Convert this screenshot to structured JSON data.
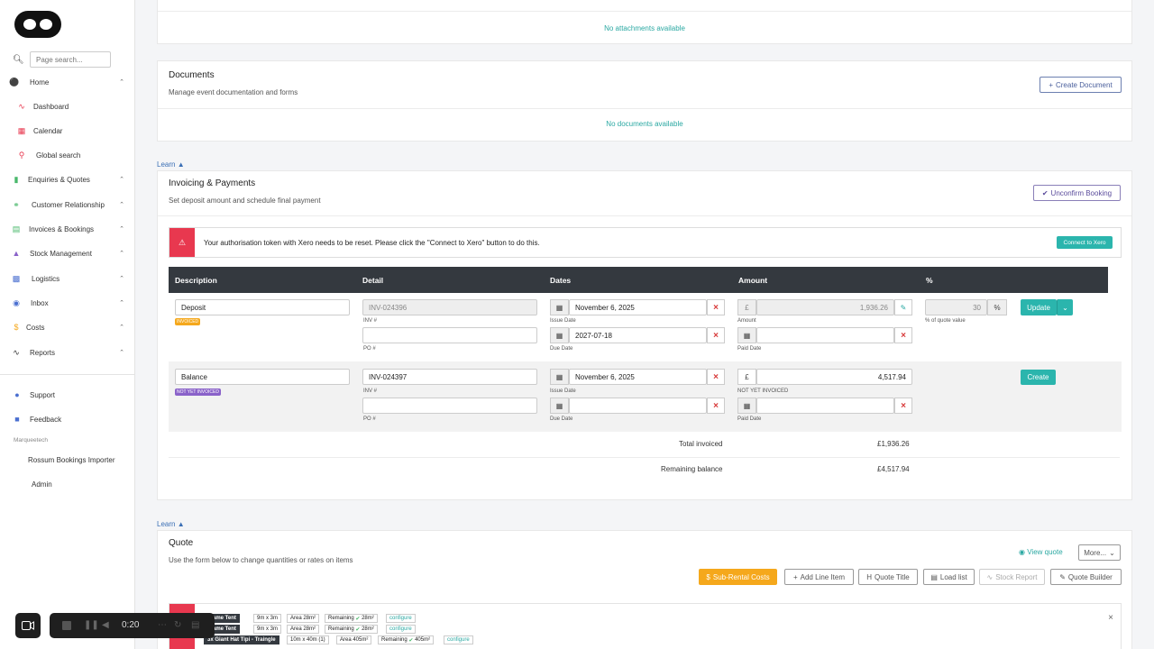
{
  "search": {
    "placeholder": "Page search..."
  },
  "nav": {
    "home": "Home",
    "dashboard": "Dashboard",
    "calendar": "Calendar",
    "global_search": "Global search",
    "enquiries": "Enquiries & Quotes",
    "crm": "Customer Relationship",
    "invoices": "Invoices & Bookings",
    "stock": "Stock Management",
    "logistics": "Logistics",
    "inbox": "Inbox",
    "costs": "Costs",
    "reports": "Reports",
    "support": "Support",
    "feedback": "Feedback",
    "section_marquee": "Marqueetech",
    "importer": "Rossum Bookings Importer",
    "admin": "Admin"
  },
  "attachments": {
    "empty": "No attachments available"
  },
  "documents": {
    "title": "Documents",
    "subtitle": "Manage event documentation and forms",
    "create_btn": "Create Document",
    "empty": "No documents available"
  },
  "learn": "Learn",
  "invoicing": {
    "title": "Invoicing & Payments",
    "subtitle": "Set deposit amount and schedule final payment",
    "unconfirm_btn": "Unconfirm Booking",
    "alert": "Your authorisation token with Xero needs to be reset. Please click the \"Connect to Xero\" button to do this.",
    "connect_btn": "Connect to Xero",
    "headers": {
      "description": "Description",
      "detail": "Detail",
      "dates": "Dates",
      "amount": "Amount",
      "percent": "%"
    },
    "rows": [
      {
        "description": "Deposit",
        "badge": "INVOICED",
        "inv": "INV-024396",
        "inv_label": "INV #",
        "po_label": "PO #",
        "issue_date": "November 6, 2025",
        "issue_label": "Issue Date",
        "due_date": "2027-07-18",
        "due_label": "Due Date",
        "currency": "£",
        "amount": "1,936.26",
        "amount_label": "Amount",
        "paid_label": "Paid Date",
        "percent": "30",
        "percent_sym": "%",
        "percent_label": "% of quote value",
        "action": "Update"
      },
      {
        "description": "Balance",
        "badge": "NOT YET INVOICED",
        "inv": "INV-024397",
        "inv_label": "INV #",
        "po_label": "PO #",
        "issue_date": "November 6, 2025",
        "issue_label": "Issue Date",
        "due_label": "Due Date",
        "currency": "£",
        "amount": "4,517.94",
        "amount_label": "NOT YET INVOICED",
        "paid_label": "Paid Date",
        "action": "Create"
      }
    ],
    "total_invoiced_label": "Total invoiced",
    "total_invoiced": "£1,936.26",
    "remaining_label": "Remaining balance",
    "remaining": "£4,517.94"
  },
  "quote": {
    "title": "Quote",
    "subtitle": "Use the form below to change quantities or rates on items",
    "view_quote": "View quote",
    "more": "More...",
    "buttons": {
      "sub_rental": "Sub-Rental Costs",
      "add_line": "Add Line Item",
      "quote_title": "Quote Title",
      "load_list": "Load list",
      "stock_report": "Stock Report",
      "quote_builder": "Quote Builder"
    },
    "items": [
      {
        "name": "Frame Tent",
        "size": "9m x 3m",
        "area": "Area 28m²",
        "remaining": "Remaining",
        "rem_val": "28m²",
        "cfg": "configure"
      },
      {
        "name": "Frame Tent",
        "size": "9m x 3m",
        "area": "Area 28m²",
        "remaining": "Remaining",
        "rem_val": "28m²",
        "cfg": "configure"
      },
      {
        "name": "3x Giant Hat Tipi - Traingle",
        "size": "10m x 40m (1)",
        "area": "Area 405m²",
        "remaining": "Remaining",
        "rem_val": "405m²",
        "cfg": "configure"
      }
    ]
  },
  "player": {
    "time": "0:20"
  }
}
